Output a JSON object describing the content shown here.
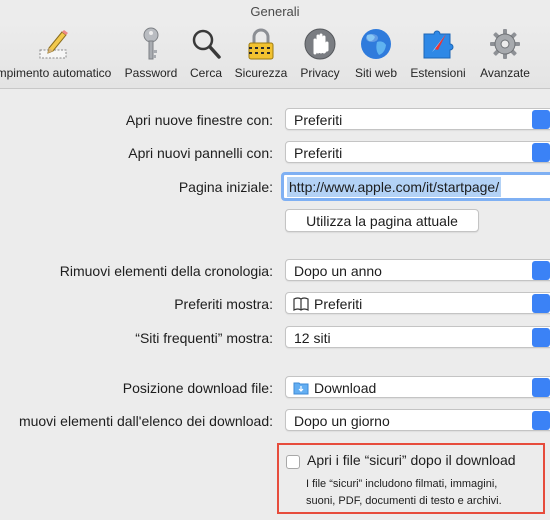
{
  "window": {
    "title": "Generali"
  },
  "toolbar": {
    "items": [
      {
        "label": "mpimento automatico",
        "icon": "pencil-form-icon"
      },
      {
        "label": "Password",
        "icon": "key-icon"
      },
      {
        "label": "Cerca",
        "icon": "magnifier-icon"
      },
      {
        "label": "Sicurezza",
        "icon": "lock-icon"
      },
      {
        "label": "Privacy",
        "icon": "hand-icon"
      },
      {
        "label": "Siti web",
        "icon": "globe-icon"
      },
      {
        "label": "Estensioni",
        "icon": "puzzle-compass-icon"
      },
      {
        "label": "Avanzate",
        "icon": "gear-icon"
      }
    ]
  },
  "settings": {
    "new_windows": {
      "label": "Apri nuove finestre con:",
      "value": "Preferiti"
    },
    "new_tabs": {
      "label": "Apri nuovi pannelli con:",
      "value": "Preferiti"
    },
    "homepage": {
      "label": "Pagina iniziale:",
      "value": "http://www.apple.com/it/startpage/"
    },
    "use_current_page": {
      "label": "Utilizza la pagina attuale"
    },
    "remove_history": {
      "label": "Rimuovi elementi della cronologia:",
      "value": "Dopo un anno"
    },
    "favorites_shows": {
      "label": "Preferiti mostra:",
      "value": "Preferiti"
    },
    "top_sites_shows": {
      "label": "“Siti frequenti” mostra:",
      "value": "12 siti"
    },
    "download_location": {
      "label": "Posizione download file:",
      "value": "Download"
    },
    "remove_downloads": {
      "label": "muovi elementi dall'elenco dei download:",
      "value": "Dopo un giorno"
    },
    "open_safe_files": {
      "label": "Apri i file “sicuri” dopo il download",
      "checked": false,
      "help_line1": "I file “sicuri” includono filmati, immagini,",
      "help_line2": "suoni, PDF, documenti di testo e archivi."
    }
  },
  "colors": {
    "accent": "#3b82f6",
    "highlight_box": "#e74c3c",
    "selection": "#b3d2f6"
  }
}
